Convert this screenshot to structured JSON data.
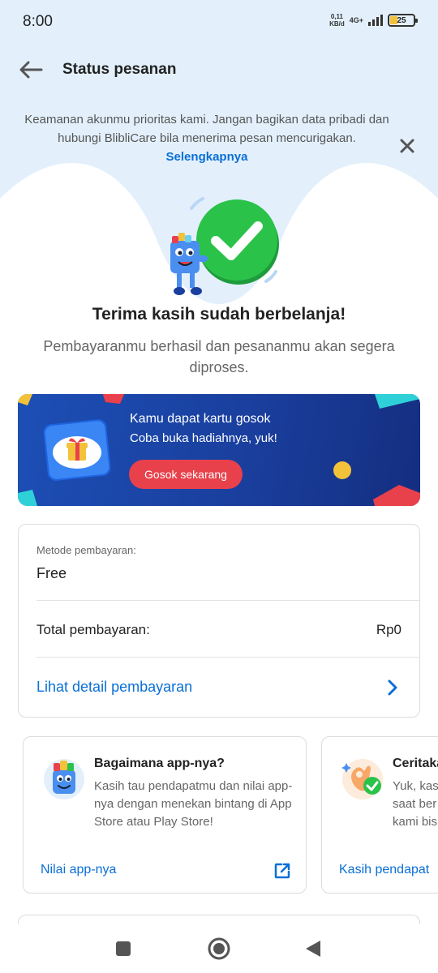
{
  "status_bar": {
    "time": "8:00",
    "net_speed_value": "0,11",
    "net_speed_unit": "KB/d",
    "network": "4G+",
    "battery": "25"
  },
  "app_bar": {
    "title": "Status pesanan",
    "back_icon": "arrow-left-icon"
  },
  "notice": {
    "text": "Keamanan akunmu prioritas kami. Jangan bagikan data pribadi dan hubungi BlibliCare bila menerima pesan mencurigakan.",
    "link": "Selengkapnya",
    "close_icon": "close-icon"
  },
  "hero": {
    "title": "Terima kasih sudah berbelanja!",
    "subtitle": "Pembayaranmu berhasil dan pesananmu akan segera diproses."
  },
  "banner": {
    "title": "Kamu dapat kartu gosok",
    "subtitle": "Coba buka hadiahnya, yuk!",
    "button": "Gosok sekarang"
  },
  "payment": {
    "method_label": "Metode pembayaran:",
    "method_value": "Free",
    "total_label": "Total pembayaran:",
    "total_value": "Rp0",
    "detail_link": "Lihat detail pembayaran"
  },
  "feedback_cards": [
    {
      "title": "Bagaimana app-nya?",
      "description": "Kasih tau pendapatmu dan nilai app-nya dengan menekan bintang di App Store atau Play Store!",
      "link": "Nilai app-nya",
      "icon": "mascot-icon"
    },
    {
      "title": "Ceritaka",
      "description_lines": [
        "Yuk, kas",
        "saat ber",
        "kami bis"
      ],
      "link": "Kasih pendapat",
      "icon": "ok-hand-icon"
    }
  ],
  "colors": {
    "accent_blue": "#0a6fd6",
    "success_green": "#2bc24a",
    "banner_blue": "#1a3f9e",
    "button_red": "#e8414b",
    "notice_bg": "#e3f0fc"
  }
}
